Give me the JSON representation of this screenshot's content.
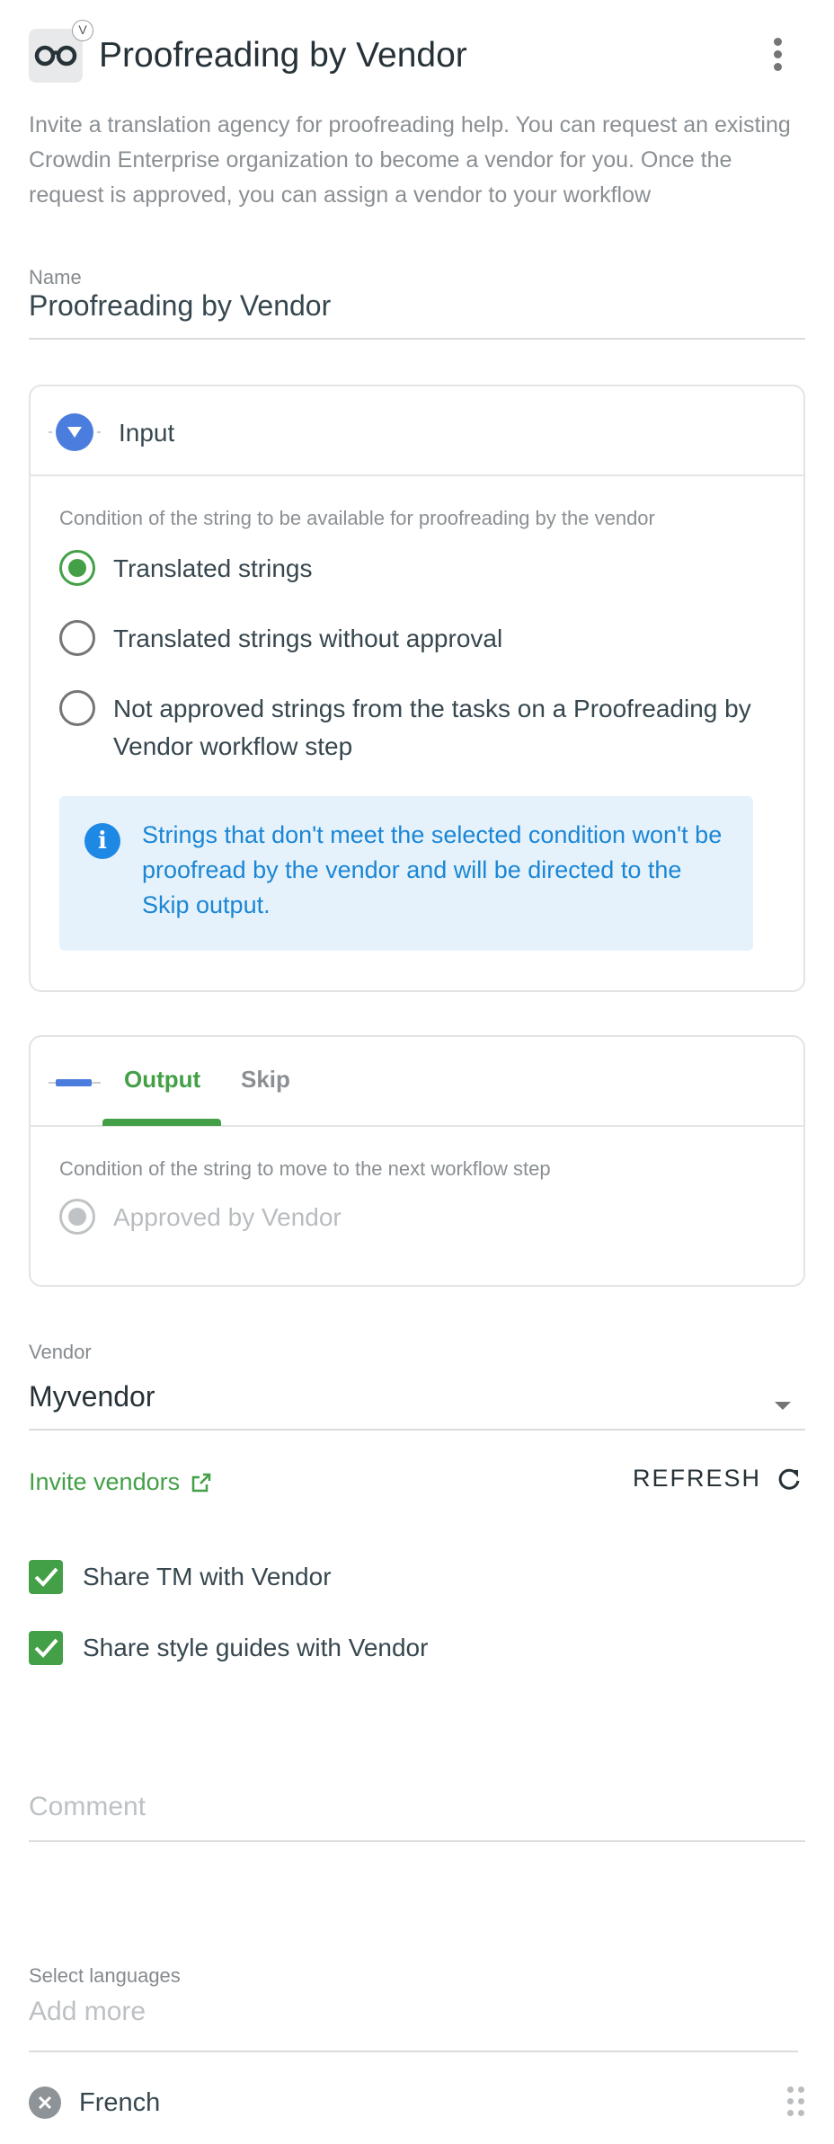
{
  "header": {
    "logo_badge": "V",
    "title": "Proofreading by Vendor",
    "menu_icon": "kebab-menu-icon"
  },
  "description": "Invite a translation agency for proofreading help. You can request an existing Crowdin Enterprise organization to become a vendor for you. Once the request is approved, you can assign a vendor to your workflow",
  "name_field": {
    "label": "Name",
    "value": "Proofreading by Vendor"
  },
  "input_card": {
    "title": "Input",
    "condition_label": "Condition of the string to be available for proofreading by the vendor",
    "options": [
      {
        "label": "Translated strings",
        "selected": true
      },
      {
        "label": "Translated strings without approval",
        "selected": false
      },
      {
        "label": "Not approved strings from the tasks on a Proofreading by Vendor workflow step",
        "selected": false
      }
    ],
    "info": "Strings that don't meet the selected condition won't be proofread by the vendor and will be directed to the Skip output."
  },
  "output_card": {
    "tabs": [
      {
        "label": "Output",
        "active": true
      },
      {
        "label": "Skip",
        "active": false
      }
    ],
    "condition_label": "Condition of the string to move to the next workflow step",
    "option": {
      "label": "Approved by Vendor",
      "disabled": true
    }
  },
  "vendor": {
    "label": "Vendor",
    "value": "Myvendor",
    "invite_label": "Invite vendors",
    "refresh_label": "REFRESH"
  },
  "checkboxes": [
    {
      "label": "Share TM with Vendor",
      "checked": true
    },
    {
      "label": "Share style guides with Vendor",
      "checked": true
    }
  ],
  "comment": {
    "placeholder": "Comment"
  },
  "languages": {
    "label": "Select languages",
    "placeholder": "Add more",
    "selected": [
      "French"
    ]
  },
  "colors": {
    "accent_green": "#43a047",
    "node_blue": "#4a7dde",
    "info_blue": "#1e88e5",
    "info_bg": "#e5f2fc"
  }
}
